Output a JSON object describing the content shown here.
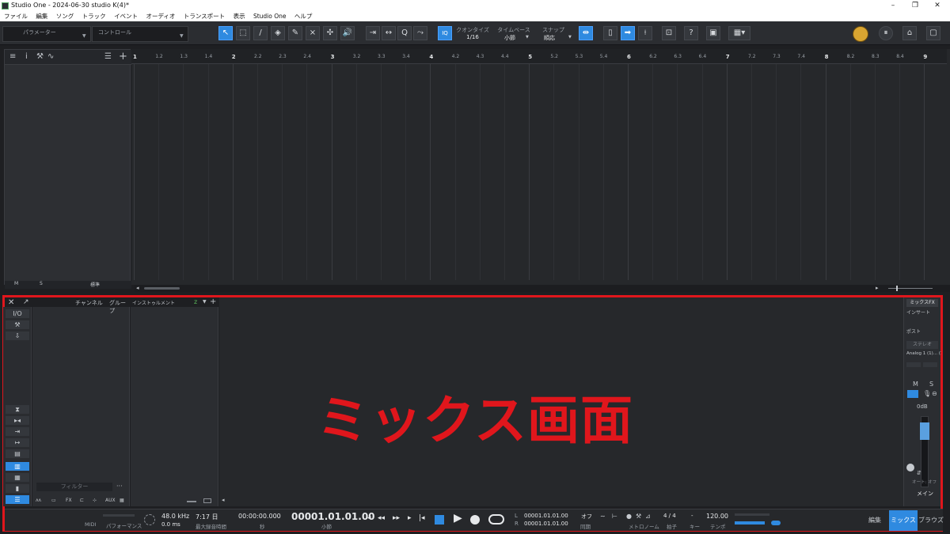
{
  "window": {
    "title": "Studio One - 2024-06-30 studio K(4)*",
    "minimize": "–",
    "maximize": "❐",
    "close": "✕"
  },
  "menu": [
    "ファイル",
    "編集",
    "ソング",
    "トラック",
    "イベント",
    "オーディオ",
    "トランスポート",
    "表示",
    "Studio One",
    "ヘルプ"
  ],
  "toolbar": {
    "param_label": "パラメーター",
    "control_label": "コントロール",
    "quantize_label": "クオンタイズ",
    "quantize_value": "1/16",
    "timebase_label": "タイムベース",
    "timebase_value": "小節",
    "snap_label": "スナップ",
    "snap_value": "順応",
    "iq_label": "IQ"
  },
  "ruler": {
    "ticks": [
      "1",
      "1.2",
      "1.3",
      "1.4",
      "2",
      "2.2",
      "2.3",
      "2.4",
      "3",
      "3.2",
      "3.3",
      "3.4",
      "4",
      "4.2",
      "4.3",
      "4.4",
      "5",
      "5.2",
      "5.3",
      "5.4",
      "6",
      "6.2",
      "6.3",
      "6.4",
      "7",
      "7.2",
      "7.3",
      "7.4",
      "8",
      "8.2",
      "8.3",
      "8.4",
      "9"
    ]
  },
  "left_panel": {
    "footer_m": "M",
    "footer_s": "S",
    "footer_mode": "標準"
  },
  "mixer": {
    "channel_header": "チャンネル",
    "group_header": "グループ",
    "instrument_header": "インストゥルメント",
    "io_label": "I/O",
    "filter_placeholder": "フィルター",
    "bottom_icons": [
      "AUX"
    ],
    "right_title": "ミックスFX",
    "insert_label": "インサート",
    "post_label": "ポスト",
    "stereo_label": "ステレオ",
    "output_label": "Analog 1 (1)... (1)",
    "m_label": "M",
    "s_label": "S",
    "db_value": "0dB",
    "auto_label": "オート: オフ",
    "main_label": "メイン"
  },
  "overlay": "ミックス画面",
  "transport": {
    "midi_label": "MIDI",
    "perf_label": "パフォーマンス",
    "sample_rate": "48.0 kHz",
    "latency": "0.0 ms",
    "record_time": "7:17 日",
    "record_time_label": "最大録音時間",
    "time_value": "00:00:00.000",
    "time_unit": "秒",
    "bar_value": "00001.01.01.00",
    "bar_unit": "小節",
    "loop_l": "00001.01.01.00",
    "loop_r": "00001.01.01.00",
    "l_label": "L",
    "r_label": "R",
    "sync_value": "オフ",
    "sync_label": "同期",
    "metronome_label": "メトロノーム",
    "sig_value": "4 / 4",
    "sig_label": "拍子",
    "key_value": "-",
    "key_label": "キー",
    "tempo_value": "120.00",
    "tempo_label": "テンポ"
  },
  "modes": {
    "edit": "編集",
    "mix": "ミックス",
    "browse": "ブラウズ"
  }
}
